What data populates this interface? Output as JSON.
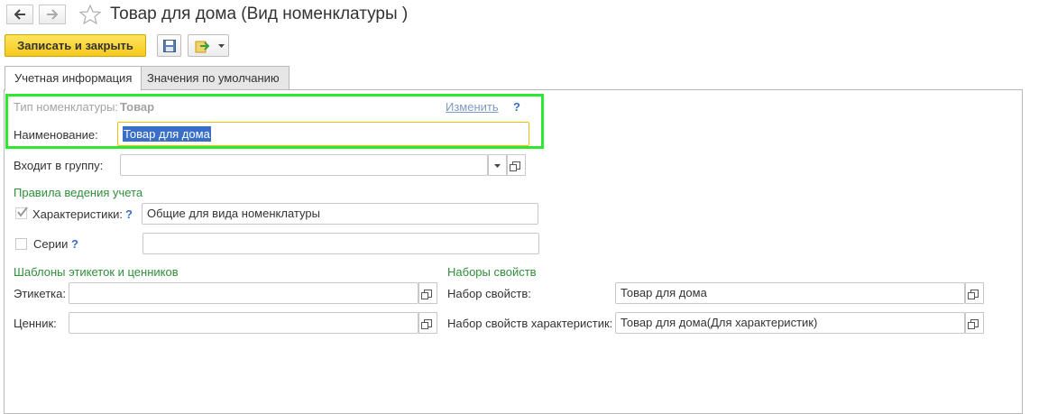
{
  "window": {
    "title": "Товар для дома (Вид номенклатуры )"
  },
  "toolbar": {
    "save_close_label": "Записать и закрыть"
  },
  "tabs": [
    {
      "label": "Учетная информация",
      "active": true
    },
    {
      "label": "Значения по умолчанию",
      "active": false
    }
  ],
  "form": {
    "type_label": "Тип номенклатуры:",
    "type_value": "Товар",
    "change_link": "Изменить",
    "help_mark": "?",
    "name_label": "Наименование:",
    "name_value": "Товар для дома",
    "group_label": "Входит в группу:",
    "group_value": "",
    "accounting_section": "Правила ведения учета",
    "characteristics_label": "Характеристики:",
    "characteristics_checked": true,
    "characteristics_value": "Общие для вида номенклатуры",
    "series_label": "Серии",
    "series_checked": false,
    "series_value": "",
    "templates_section": "Шаблоны этикеток и ценников",
    "label_label": "Этикетка:",
    "label_value": "",
    "price_tag_label": "Ценник:",
    "price_tag_value": "",
    "property_sets_section": "Наборы свойств",
    "property_set_label": "Набор свойств:",
    "property_set_value": "Товар для дома",
    "char_property_set_label": "Набор свойств характеристик:",
    "char_property_set_value": "Товар для дома(Для характеристик)"
  },
  "colors": {
    "primary_button": "#f6c91c",
    "section_header": "#2f8f3a",
    "highlight_box": "#2ee82e",
    "focus_border": "#f0c000",
    "selection": "#3a6fc8"
  }
}
